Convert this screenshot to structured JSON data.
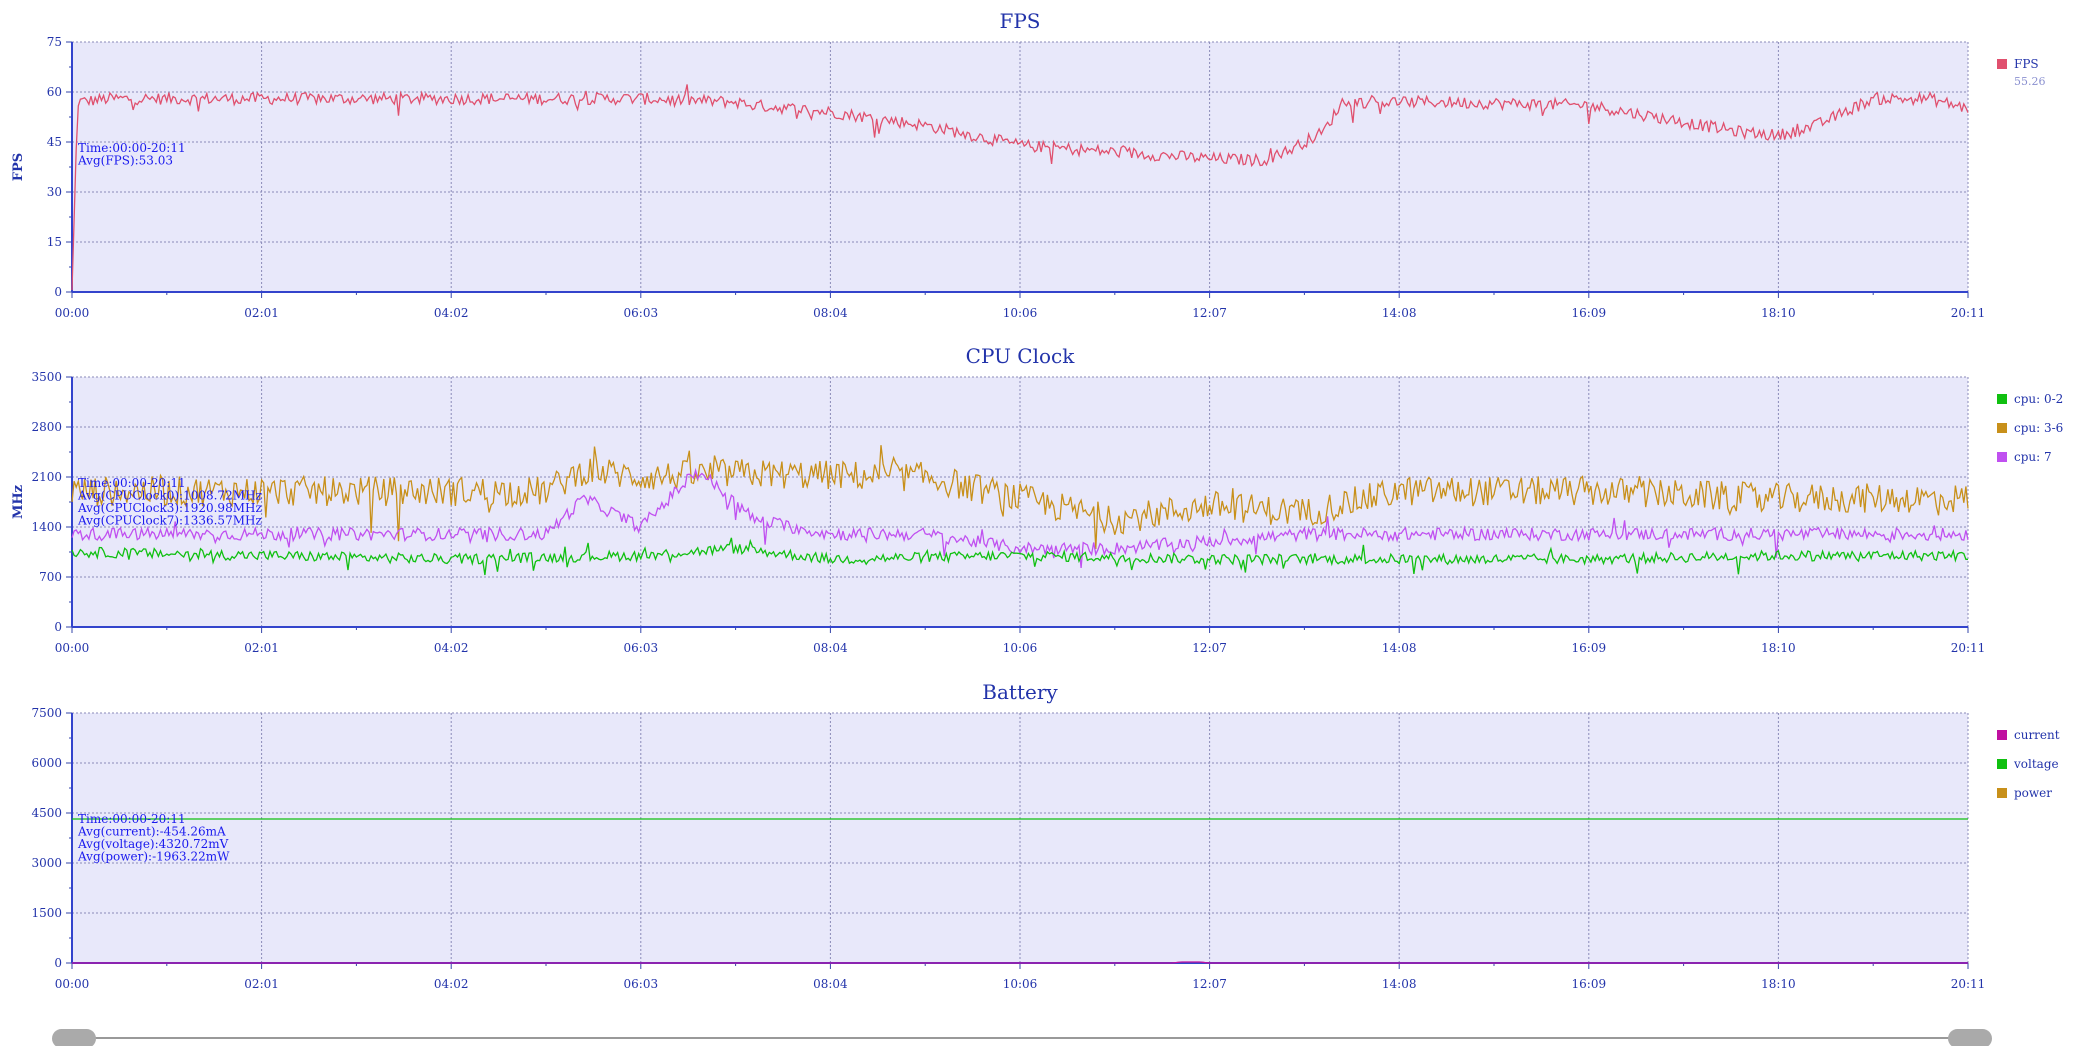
{
  "chart_data": [
    {
      "type": "line",
      "title": "FPS",
      "ylabel": "FPS",
      "ylim": [
        0,
        75
      ],
      "yticks": [
        "0",
        "15",
        "30",
        "45",
        "60",
        "75"
      ],
      "xticks": [
        "00:00",
        "02:01",
        "04:02",
        "06:03",
        "08:04",
        "10:06",
        "12:07",
        "14:08",
        "16:09",
        "18:10",
        "20:11"
      ],
      "grid": true,
      "legend_position": "right",
      "stats": [
        "Time:00:00-20:11",
        "Avg(FPS):53.03"
      ],
      "legend": [
        {
          "name": "FPS",
          "color": "#e0506e",
          "sub": "55.26"
        }
      ],
      "series": [
        {
          "name": "FPS",
          "color": "#e0506e",
          "noise": 3,
          "keyframes": [
            [
              0,
              0
            ],
            [
              0.003,
              57
            ],
            [
              0.02,
              58
            ],
            [
              0.1,
              58
            ],
            [
              0.3,
              58
            ],
            [
              0.35,
              57
            ],
            [
              0.36,
              56
            ],
            [
              0.4,
              54
            ],
            [
              0.45,
              50
            ],
            [
              0.5,
              44
            ],
            [
              0.55,
              42
            ],
            [
              0.6,
              40
            ],
            [
              0.63,
              39.5
            ],
            [
              0.6,
              40
            ],
            [
              0.64,
              42
            ],
            [
              0.66,
              48
            ],
            [
              0.67,
              57
            ],
            [
              0.72,
              57
            ],
            [
              0.8,
              56
            ],
            [
              0.83,
              53
            ],
            [
              0.88,
              48
            ],
            [
              0.9,
              47
            ],
            [
              0.92,
              50
            ],
            [
              0.95,
              58
            ],
            [
              0.98,
              58
            ],
            [
              1.0,
              55
            ]
          ]
        }
      ]
    },
    {
      "type": "line",
      "title": "CPU Clock",
      "ylabel": "MHz",
      "ylim": [
        0,
        3500
      ],
      "yticks": [
        "0",
        "700",
        "1400",
        "2100",
        "2800",
        "3500"
      ],
      "xticks": [
        "00:00",
        "02:01",
        "04:02",
        "06:03",
        "08:04",
        "10:06",
        "12:07",
        "14:08",
        "16:09",
        "18:10",
        "20:11"
      ],
      "grid": true,
      "legend_position": "right",
      "stats": [
        "Time:00:00-20:11",
        "Avg(CPUClock0):1008.72MHz",
        "Avg(CPUClock3):1920.98MHz",
        "Avg(CPUClock7):1336.57MHz"
      ],
      "legend": [
        {
          "name": "cpu: 0-2",
          "color": "#10c010"
        },
        {
          "name": "cpu: 3-6",
          "color": "#c8901a"
        },
        {
          "name": "cpu: 7",
          "color": "#c050f0"
        }
      ],
      "series": [
        {
          "name": "cpu: 3-6",
          "color": "#c8901a",
          "noise": 350,
          "keyframes": [
            [
              0,
              1900
            ],
            [
              0.25,
              1900
            ],
            [
              0.27,
              2200
            ],
            [
              0.3,
              2100
            ],
            [
              0.35,
              2150
            ],
            [
              0.45,
              2100
            ],
            [
              0.5,
              1800
            ],
            [
              0.55,
              1500
            ],
            [
              0.6,
              1700
            ],
            [
              0.65,
              1600
            ],
            [
              0.7,
              1900
            ],
            [
              0.8,
              1900
            ],
            [
              0.9,
              1800
            ],
            [
              1.0,
              1800
            ]
          ]
        },
        {
          "name": "cpu: 7",
          "color": "#c050f0",
          "noise": 150,
          "keyframes": [
            [
              0,
              1300
            ],
            [
              0.25,
              1300
            ],
            [
              0.27,
              1800
            ],
            [
              0.3,
              1400
            ],
            [
              0.33,
              2200
            ],
            [
              0.36,
              1500
            ],
            [
              0.4,
              1300
            ],
            [
              0.45,
              1300
            ],
            [
              0.5,
              1100
            ],
            [
              0.55,
              1100
            ],
            [
              0.6,
              1200
            ],
            [
              0.65,
              1300
            ],
            [
              0.75,
              1300
            ],
            [
              0.9,
              1300
            ],
            [
              1.0,
              1300
            ]
          ]
        },
        {
          "name": "cpu: 0-2",
          "color": "#10c010",
          "noise": 120,
          "keyframes": [
            [
              0,
              1050
            ],
            [
              0.1,
              1000
            ],
            [
              0.2,
              950
            ],
            [
              0.3,
              1000
            ],
            [
              0.35,
              1100
            ],
            [
              0.4,
              950
            ],
            [
              0.5,
              1000
            ],
            [
              0.6,
              950
            ],
            [
              0.7,
              950
            ],
            [
              0.8,
              950
            ],
            [
              0.9,
              1000
            ],
            [
              1.0,
              1000
            ]
          ]
        }
      ]
    },
    {
      "type": "line",
      "title": "Battery",
      "ylabel": "",
      "ylim": [
        0,
        7500
      ],
      "yticks": [
        "0",
        "1500",
        "3000",
        "4500",
        "6000",
        "7500"
      ],
      "xticks": [
        "00:00",
        "02:01",
        "04:02",
        "06:03",
        "08:04",
        "10:06",
        "12:07",
        "14:08",
        "16:09",
        "18:10",
        "20:11"
      ],
      "grid": true,
      "legend_position": "right",
      "stats": [
        "Time:00:00-20:11",
        "Avg(current):-454.26mA",
        "Avg(voltage):4320.72mV",
        "Avg(power):-1963.22mW"
      ],
      "legend": [
        {
          "name": "current",
          "color": "#c010a0"
        },
        {
          "name": "voltage",
          "color": "#10c010"
        },
        {
          "name": "power",
          "color": "#c8901a"
        }
      ],
      "series": [
        {
          "name": "voltage",
          "color": "#10c010",
          "noise": 0,
          "keyframes": [
            [
              0,
              4320
            ],
            [
              1.0,
              4320
            ]
          ]
        },
        {
          "name": "current",
          "color": "#c010a0",
          "noise": 0,
          "keyframes": [
            [
              0,
              0
            ],
            [
              0.58,
              0
            ],
            [
              0.585,
              30
            ],
            [
              0.595,
              30
            ],
            [
              0.6,
              0
            ],
            [
              1.0,
              0
            ]
          ]
        }
      ]
    }
  ],
  "scroll": {
    "left_handle": "drag-handle-start",
    "right_handle": "drag-handle-end"
  }
}
